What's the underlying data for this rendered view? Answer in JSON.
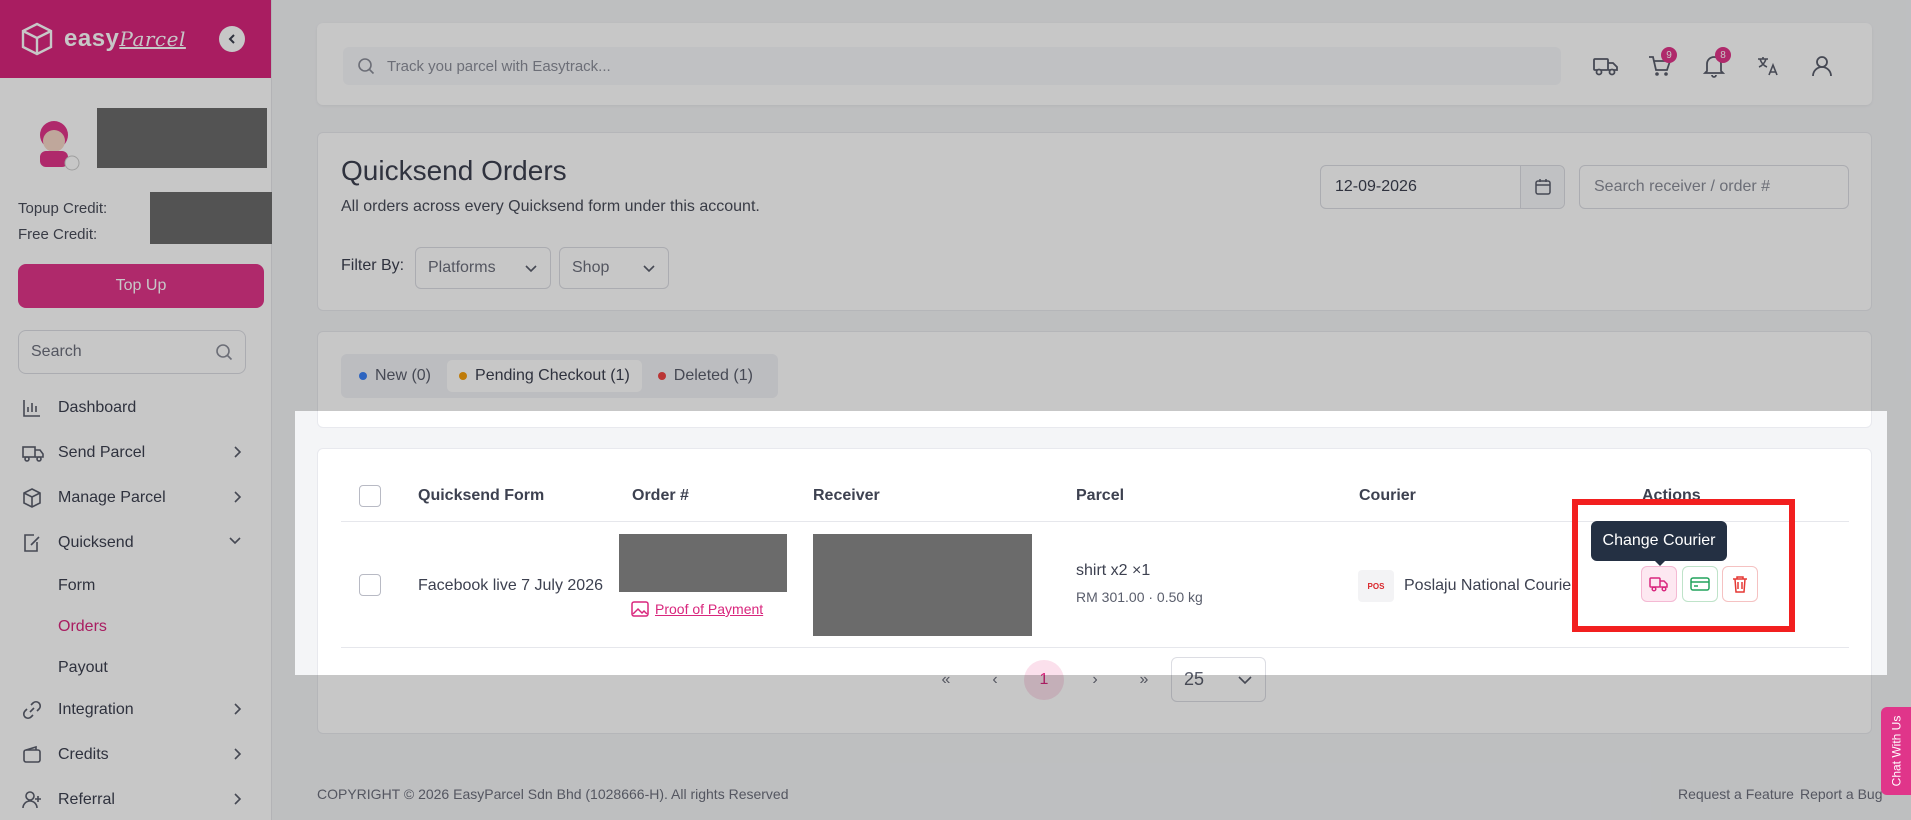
{
  "brand": {
    "name": "easy",
    "sub": "Parcel"
  },
  "sidebar": {
    "topup_credit_label": "Topup Credit:",
    "free_credit_label": "Free Credit:",
    "topup_button": "Top Up",
    "search_placeholder": "Search",
    "items": [
      {
        "label": "Dashboard",
        "icon": "chart-bars-icon"
      },
      {
        "label": "Send Parcel",
        "icon": "truck-icon"
      },
      {
        "label": "Manage Parcel",
        "icon": "box-icon"
      },
      {
        "label": "Quicksend",
        "icon": "edit-doc-icon"
      },
      {
        "label": "Integration",
        "icon": "link-icon"
      },
      {
        "label": "Credits",
        "icon": "wallet-icon"
      },
      {
        "label": "Referral",
        "icon": "user-plus-icon"
      }
    ],
    "quicksend_sub": [
      "Form",
      "Orders",
      "Payout"
    ]
  },
  "topbar": {
    "track_placeholder": "Track you parcel with Easytrack...",
    "cart_count": "9",
    "notif_count": "8"
  },
  "header": {
    "title": "Quicksend Orders",
    "subtitle": "All orders across every Quicksend form under this account.",
    "date": "12-09-2026",
    "search_placeholder": "Search receiver / order #",
    "filter_label": "Filter By:",
    "platforms": "Platforms",
    "shop": "Shop"
  },
  "tabs": [
    {
      "label": "New (0)",
      "color": "#3b82f6"
    },
    {
      "label": "Pending Checkout (1)",
      "color": "#f59e0b"
    },
    {
      "label": "Deleted (1)",
      "color": "#ef4444"
    }
  ],
  "table": {
    "headers": [
      "Quicksend Form",
      "Order #",
      "Receiver",
      "Parcel",
      "Courier",
      "Actions"
    ],
    "row": {
      "form": "Facebook live 7 July 2026",
      "proof": "Proof of Payment",
      "parcel_line1": "shirt x2  ×1",
      "parcel_line2": "RM 301.00 · 0.50 kg",
      "courier_logo": "POS",
      "courier": "Poslaju National Courier"
    },
    "tooltip": "Change Courier"
  },
  "pagination": {
    "first": "«",
    "prev": "‹",
    "page": "1",
    "next": "›",
    "last": "»",
    "per_page": "25"
  },
  "footer": {
    "copyright": "COPYRIGHT © 2026 EasyParcel Sdn Bhd (1028666-H). All rights Reserved",
    "request": "Request a Feature",
    "report": "Report a Bug"
  },
  "chat": "Chat With Us",
  "colors": {
    "brand": "#d9267d",
    "accent": "#e0358a"
  }
}
